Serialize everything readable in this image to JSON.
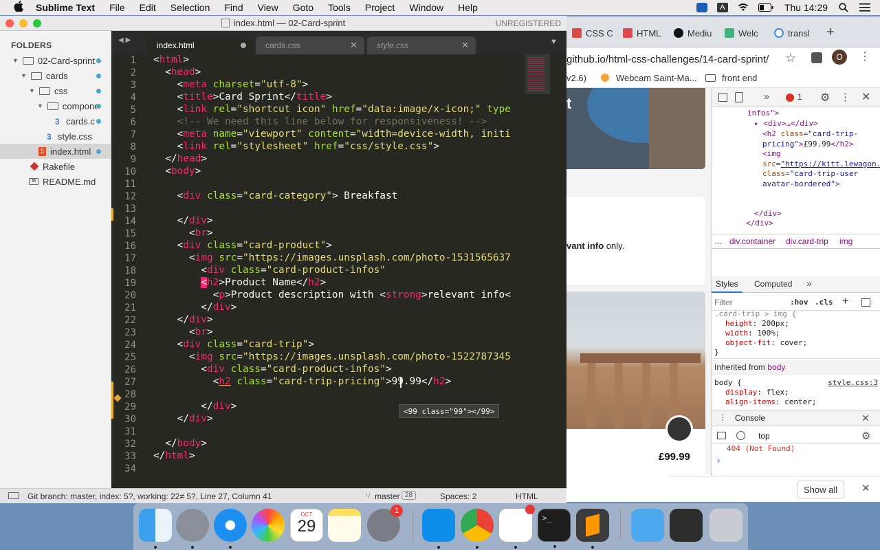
{
  "menubar": {
    "app": "Sublime Text",
    "items": [
      "File",
      "Edit",
      "Selection",
      "Find",
      "View",
      "Goto",
      "Tools",
      "Project",
      "Window",
      "Help"
    ],
    "clock": "Thu 14:29"
  },
  "sublime": {
    "title": "index.html — 02-Card-sprint",
    "unregistered": "UNREGISTERED",
    "folders_label": "FOLDERS",
    "tree": [
      {
        "label": "02-Card-sprint",
        "type": "folder"
      },
      {
        "label": "cards",
        "type": "folder"
      },
      {
        "label": "css",
        "type": "folder"
      },
      {
        "label": "compone",
        "type": "folder"
      },
      {
        "label": "cards.c",
        "type": "css"
      },
      {
        "label": "style.css",
        "type": "css"
      },
      {
        "label": "index.html",
        "type": "html"
      },
      {
        "label": "Rakefile",
        "type": "ruby"
      },
      {
        "label": "README.md",
        "type": "md"
      }
    ],
    "tabs": [
      {
        "label": "index.html"
      },
      {
        "label": "cards.css"
      },
      {
        "label": "style.css"
      }
    ],
    "autocomplete": "<99 class=\"99\"></99>",
    "status": {
      "git": "Git branch: master, index: 5?, working: 22≠ 5?, Line 27, Column 41",
      "branch": "master",
      "branch_count": "28",
      "spaces": "Spaces: 2",
      "syntax": "HTML"
    }
  },
  "chrome": {
    "tabs": [
      "CSS C",
      "HTML",
      "Mediu",
      "Welc",
      "transl"
    ],
    "url": "github.io/html-css-challenges/14-card-sprint/",
    "avatar_letter": "O",
    "bookmarks": [
      "v2.6)",
      "Webcam Saint-Ma...",
      "front end"
    ],
    "page": {
      "relevant": "vant info",
      "only": "only.",
      "price": "£99.99",
      "letter": "t"
    },
    "devtools": {
      "error_count": "1",
      "breadcrumbs": [
        "div.container",
        "div.card-trip",
        "img"
      ],
      "tabs": [
        "Styles",
        "Computed"
      ],
      "filter_placeholder": "Filter",
      "hov": ":hov",
      "cls": ".cls",
      "inherited": "Inherited from",
      "inherited_el": "body",
      "source1": "style.css:3",
      "console_label": "Console",
      "context": "top",
      "console_error": "404 (Not Found)",
      "show_all": "Show all"
    }
  }
}
